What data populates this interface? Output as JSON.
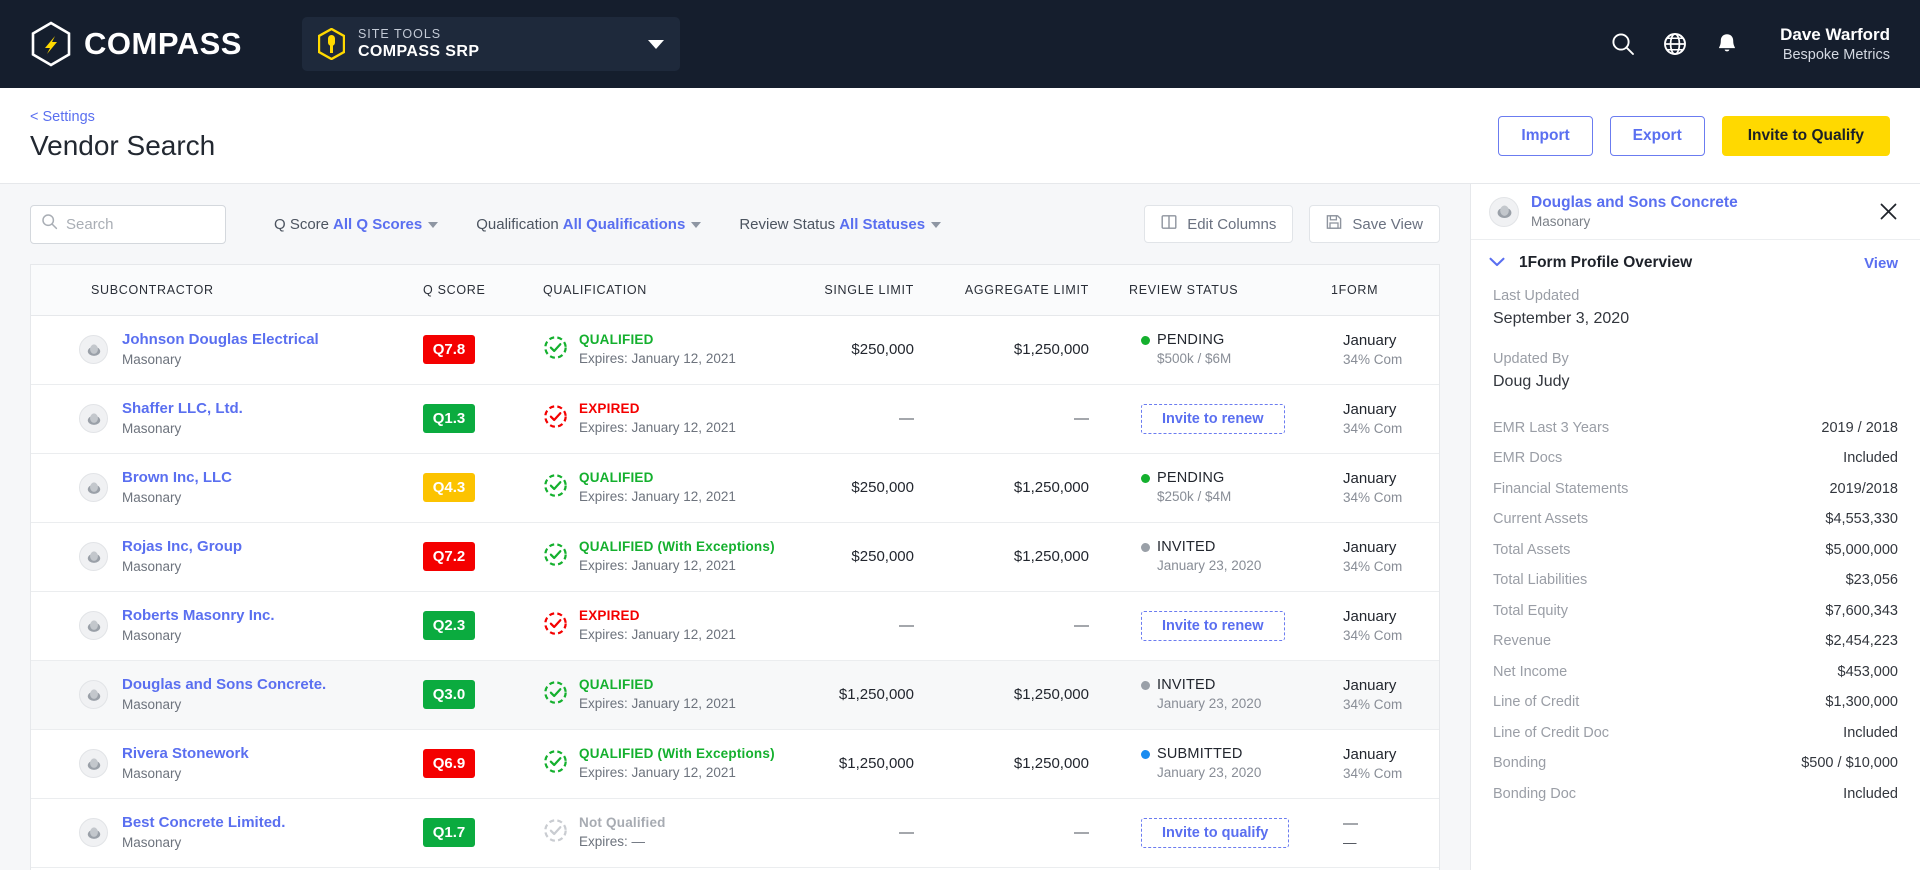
{
  "topnav": {
    "brand": "COMPASS",
    "site_tools": {
      "eyebrow": "SITE TOOLS",
      "value": "COMPASS SRP"
    },
    "icons": {
      "search": "search-icon",
      "globe": "globe-icon",
      "bell": "bell-icon"
    },
    "user": {
      "name": "Dave Warford",
      "org": "Bespoke Metrics"
    }
  },
  "pagehead": {
    "breadcrumb": "< Settings",
    "title": "Vendor Search",
    "import_label": "Import",
    "export_label": "Export",
    "invite_label": "Invite to Qualify"
  },
  "toolbar": {
    "search_placeholder": "Search",
    "search_value": "",
    "filters": [
      {
        "label": "Q Score",
        "value": "All Q Scores"
      },
      {
        "label": "Qualification",
        "value": "All Qualifications"
      },
      {
        "label": "Review Status",
        "value": "All Statuses"
      }
    ],
    "edit_columns_label": "Edit Columns",
    "save_view_label": "Save View"
  },
  "table": {
    "columns": [
      "SUBCONTRACTOR",
      "Q SCORE",
      "QUALIFICATION",
      "SINGLE LIMIT",
      "AGGREGATE LIMIT",
      "REVIEW STATUS",
      "1FORM"
    ],
    "rows": [
      {
        "name": "Johnson Douglas Electrical",
        "trade": "Masonary",
        "q_score": "Q7.8",
        "q_color": "#f40000",
        "qual_state": "qualified",
        "qual_label": "QUALIFIED",
        "qual_expires": "Expires: January 12, 2021",
        "single_limit": "$250,000",
        "aggregate_limit": "$1,250,000",
        "review_type": "status",
        "review_label": "PENDING",
        "review_dot": "#14b02e",
        "review_sub": "$500k / $6M",
        "form_date": "January",
        "form_pct": "34% Com"
      },
      {
        "name": "Shaffer LLC, Ltd.",
        "trade": "Masonary",
        "q_score": "Q1.3",
        "q_color": "#0bab3f",
        "qual_state": "expired",
        "qual_label": "EXPIRED",
        "qual_expires": "Expires: January 12, 2021",
        "single_limit": "—",
        "aggregate_limit": "—",
        "review_type": "button",
        "review_label": "Invite to renew",
        "review_dot": "",
        "review_sub": "",
        "form_date": "January",
        "form_pct": "34% Com"
      },
      {
        "name": "Brown Inc, LLC",
        "trade": "Masonary",
        "q_score": "Q4.3",
        "q_color": "#fcc300",
        "qual_state": "qualified",
        "qual_label": "QUALIFIED",
        "qual_expires": "Expires: January 12, 2021",
        "single_limit": "$250,000",
        "aggregate_limit": "$1,250,000",
        "review_type": "status",
        "review_label": "PENDING",
        "review_dot": "#14b02e",
        "review_sub": "$250k / $4M",
        "form_date": "January",
        "form_pct": "34% Com"
      },
      {
        "name": "Rojas Inc, Group",
        "trade": "Masonary",
        "q_score": "Q7.2",
        "q_color": "#f40000",
        "qual_state": "qualified",
        "qual_label": "QUALIFIED (With Exceptions)",
        "qual_expires": "Expires: January 12, 2021",
        "single_limit": "$250,000",
        "aggregate_limit": "$1,250,000",
        "review_type": "status",
        "review_label": "INVITED",
        "review_dot": "#9aa0a8",
        "review_sub": "January 23, 2020",
        "form_date": "January",
        "form_pct": "34% Com"
      },
      {
        "name": "Roberts Masonry Inc.",
        "trade": "Masonary",
        "q_score": "Q2.3",
        "q_color": "#0bab3f",
        "qual_state": "expired",
        "qual_label": "EXPIRED",
        "qual_expires": "Expires: January 12, 2021",
        "single_limit": "—",
        "aggregate_limit": "—",
        "review_type": "button",
        "review_label": "Invite to renew",
        "review_dot": "",
        "review_sub": "",
        "form_date": "January",
        "form_pct": "34% Com"
      },
      {
        "name": "Douglas and Sons Concrete.",
        "trade": "Masonary",
        "q_score": "Q3.0",
        "q_color": "#0bab3f",
        "qual_state": "qualified",
        "qual_label": "QUALIFIED",
        "qual_expires": "Expires: January 12, 2021",
        "single_limit": "$1,250,000",
        "aggregate_limit": "$1,250,000",
        "review_type": "status",
        "review_label": "INVITED",
        "review_dot": "#9aa0a8",
        "review_sub": "January 23, 2020",
        "form_date": "January",
        "form_pct": "34% Com",
        "selected": true
      },
      {
        "name": "Rivera Stonework",
        "trade": "Masonary",
        "q_score": "Q6.9",
        "q_color": "#f40000",
        "qual_state": "qualified",
        "qual_label": "QUALIFIED (With Exceptions)",
        "qual_expires": "Expires: January 12, 2021",
        "single_limit": "$1,250,000",
        "aggregate_limit": "$1,250,000",
        "review_type": "status",
        "review_label": "SUBMITTED",
        "review_dot": "#1a8cf0",
        "review_sub": "January 23, 2020",
        "form_date": "January",
        "form_pct": "34% Com"
      },
      {
        "name": "Best Concrete Limited.",
        "trade": "Masonary",
        "q_score": "Q1.7",
        "q_color": "#0bab3f",
        "qual_state": "none",
        "qual_label": "Not Qualified",
        "qual_expires": "Expires: —",
        "single_limit": "—",
        "aggregate_limit": "—",
        "review_type": "button",
        "review_label": "Invite to qualify",
        "review_dot": "",
        "review_sub": "",
        "form_date": "—",
        "form_pct": "—"
      }
    ]
  },
  "panel": {
    "company": "Douglas and Sons Concrete",
    "trade": "Masonary",
    "section_title": "1Form Profile Overview",
    "view_label": "View",
    "last_updated_label": "Last Updated",
    "last_updated_value": "September 3, 2020",
    "updated_by_label": "Updated By",
    "updated_by_value": "Doug Judy",
    "rows": [
      {
        "k": "EMR Last 3 Years",
        "v": "2019 / 2018"
      },
      {
        "k": "EMR Docs",
        "v": "Included"
      },
      {
        "k": "Financial Statements",
        "v": "2019/2018"
      },
      {
        "k": "Current Assets",
        "v": "$4,553,330"
      },
      {
        "k": "Total Assets",
        "v": "$5,000,000"
      },
      {
        "k": "Total Liabilities",
        "v": "$23,056"
      },
      {
        "k": "Total Equity",
        "v": "$7,600,343"
      },
      {
        "k": "Revenue",
        "v": "$2,454,223"
      },
      {
        "k": "Net Income",
        "v": "$453,000"
      },
      {
        "k": "Line of Credit",
        "v": "$1,300,000"
      },
      {
        "k": "Line of Credit Doc",
        "v": "Included"
      },
      {
        "k": "Bonding",
        "v": "$500 / $10,000"
      },
      {
        "k": "Bonding Doc",
        "v": "Included"
      }
    ]
  }
}
